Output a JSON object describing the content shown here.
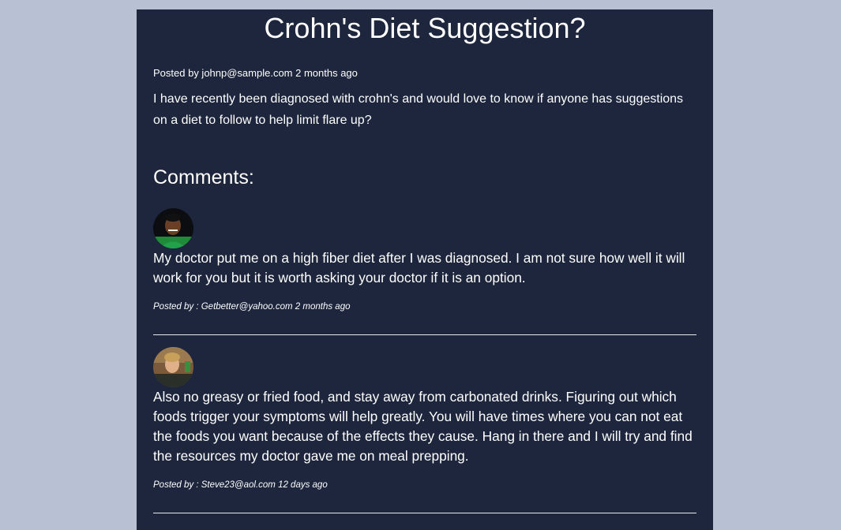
{
  "post": {
    "title": "Crohn's Diet Suggestion?",
    "posted_by": "Posted by johnp@sample.com 2 months ago",
    "body": "I have recently been diagnosed with crohn's and would love to know if anyone has suggestions on a diet to follow to help limit flare up?"
  },
  "comments_heading": "Comments:",
  "comments": [
    {
      "text": "My doctor put me on a high fiber diet after I was diagnosed. I am not sure how well it will work for you but it is worth asking your doctor if it is an option.",
      "meta": "Posted by : Getbetter@yahoo.com 2 months ago"
    },
    {
      "text": "Also no greasy or fried food, and stay away from carbonated drinks. Figuring out which foods trigger your symptoms will help greatly. You will have times where you can not eat the foods you want because of the effects they cause. Hang in there and I will try and find the resources my doctor gave me on meal prepping.",
      "meta": "Posted by : Steve23@aol.com 12 days ago"
    }
  ],
  "colors": {
    "page_background": "#b7c1d3",
    "panel_background": "#1d263d",
    "text": "#ffffff"
  }
}
